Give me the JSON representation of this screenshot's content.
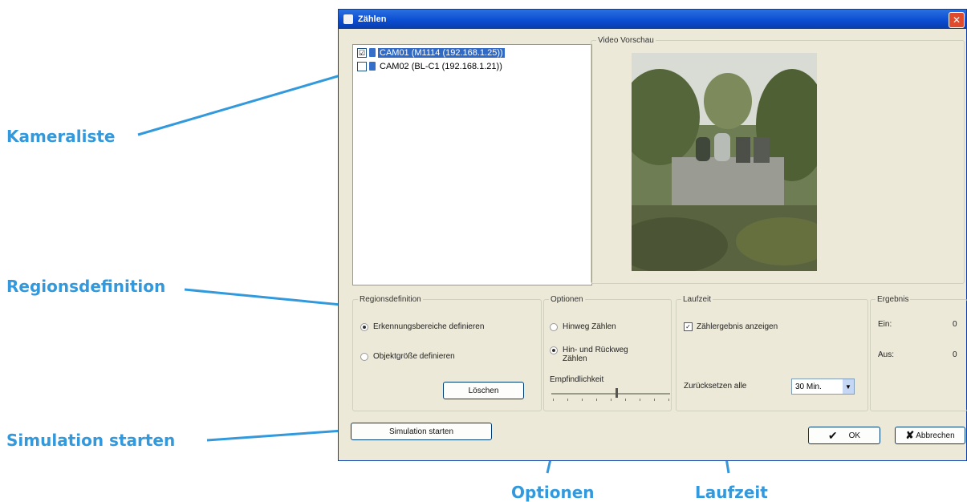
{
  "callouts": {
    "kameraliste": "Kameraliste",
    "regionsdefinition": "Regionsdefinition",
    "simulation": "Simulation starten",
    "optionen": "Optionen",
    "laufzeit": "Laufzeit"
  },
  "dialog": {
    "title": "Zählen",
    "cameras": [
      {
        "label": "CAM01 (M1114 (192.168.1.25))",
        "checked": "☑",
        "selected": true
      },
      {
        "label": "CAM02 (BL-C1 (192.168.1.21))",
        "checked": "",
        "selected": false
      }
    ],
    "preview_legend": "Video Vorschau",
    "regions": {
      "legend": "Regionsdefinition",
      "option1": "Erkennungsbereiche definieren",
      "option2": "Objektgröße definieren",
      "delete_button": "Löschen"
    },
    "options": {
      "legend": "Optionen",
      "option1": "Hinweg Zählen",
      "option2": "Hin- und Rückweg Zählen",
      "sensitivity_label": "Empfindlichkeit",
      "sensitivity_value": 0.55
    },
    "runtime": {
      "legend": "Laufzeit",
      "show_result": "Zählergebnis anzeigen",
      "reset_label": "Zurücksetzen alle",
      "reset_value": "30 Min."
    },
    "result": {
      "legend": "Ergebnis",
      "in_label": "Ein:",
      "in_value": "0",
      "out_label": "Aus:",
      "out_value": "0"
    },
    "simulate_button": "Simulation starten",
    "ok_button": "OK",
    "cancel_button": "Abbrechen"
  },
  "colors": {
    "callout": "#3399dd",
    "titlebar": "#0a4bd0"
  }
}
